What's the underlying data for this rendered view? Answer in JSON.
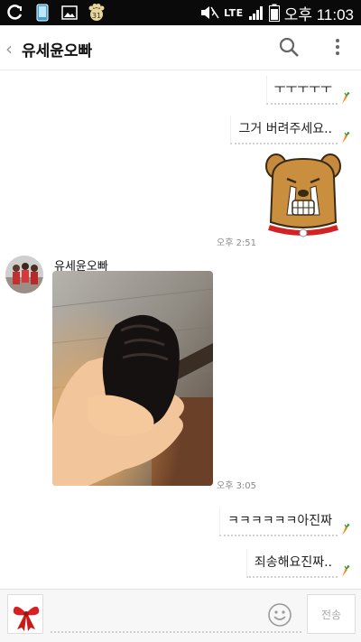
{
  "status_bar": {
    "network": "LTE",
    "time": "오후 11:03",
    "calendar_day": "31"
  },
  "header": {
    "title": "유세윤오빠",
    "back_icon": "chevron-left-icon",
    "search_icon": "search-icon",
    "more_icon": "more-vertical-icon"
  },
  "messages": [
    {
      "type": "text",
      "from": "me",
      "text": "ㅜㅜㅜㅜㅜ"
    },
    {
      "type": "text",
      "from": "me",
      "text": "그거 버려주세요.."
    },
    {
      "type": "sticker",
      "from": "me",
      "sticker": "crying-dog-sticker",
      "time": "오후 2:51"
    },
    {
      "type": "photo",
      "from": "유세윤오빠",
      "sender": "유세윤오빠",
      "time": "오후 3:05"
    },
    {
      "type": "text",
      "from": "me",
      "text": "ㅋㅋㅋㅋㅋㅋ아진짜"
    },
    {
      "type": "text",
      "from": "me",
      "text": "죄송해요진짜.."
    }
  ],
  "input_bar": {
    "value": "",
    "send_label": "전송",
    "emoji_icon": "emoji-icon",
    "gift_icon": "gift-bow-icon"
  },
  "colors": {
    "status_bar_bg": "#0a0a0a",
    "background": "#ffffff",
    "timestamp": "#8a8a8a"
  }
}
